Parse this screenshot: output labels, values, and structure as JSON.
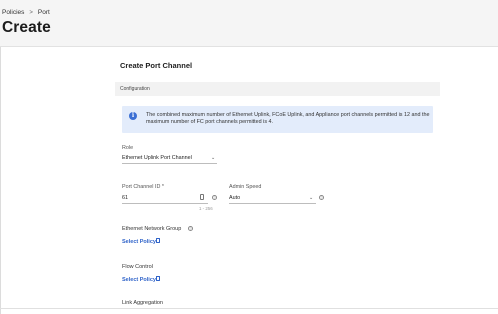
{
  "header": {
    "breadcrumb": [
      "Policies",
      "Port"
    ],
    "breadcrumb_separator": ">",
    "title": "Create"
  },
  "form": {
    "title": "Create Port Channel",
    "section": "Configuration",
    "info": "The combined maximum number of Ethernet Uplink, FCoE Uplink, and Appliance port channels permitted is 12 and the maximum number of FC port channels permitted is 4.",
    "role": {
      "label": "Role",
      "value": "Ethernet Uplink Port Channel"
    },
    "port_channel_id": {
      "label": "Port Channel ID *",
      "value": "61",
      "hint": "1 - 256"
    },
    "admin_speed": {
      "label": "Admin Speed",
      "value": "Auto"
    },
    "ethernet_network_group": {
      "label": "Ethernet Network Group",
      "link": "Select Policy"
    },
    "flow_control": {
      "label": "Flow Control",
      "link": "Select Policy"
    },
    "link_aggregation": {
      "label": "Link Aggregation"
    }
  },
  "colors": {
    "accent": "#2f63c9",
    "info_bg": "#e3ecfb",
    "info_icon": "#3b6fd4"
  }
}
